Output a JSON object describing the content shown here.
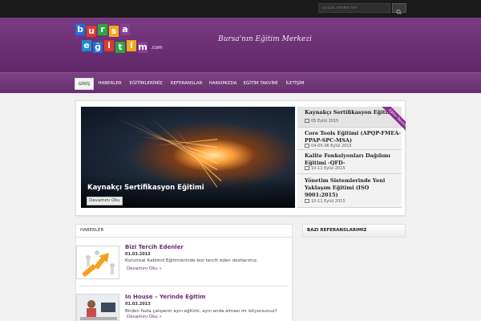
{
  "search": {
    "placeholder": "SİTEDE ARAMA YAP"
  },
  "logo": {
    "row1": [
      "b",
      "u",
      "r",
      "s",
      "a"
    ],
    "row2": [
      "e",
      "ğ",
      "i",
      "t",
      "i",
      "m"
    ],
    "suffix": ".com",
    "colors": [
      "#1f6fd6",
      "#e03c2a",
      "#2aa83a",
      "#f2a81c",
      "#8a3f9a",
      "#1b8dd1"
    ]
  },
  "tagline": "Bursa'nın Eğitim Merkezi",
  "nav": {
    "items": [
      "GİRİŞ",
      "HABERLER",
      "EĞİTİMLERİMİZ",
      "REFERANSLAR",
      "HAKKIMIZDA",
      "EĞİTİM TAKVİMİ",
      "İLETİŞİM"
    ]
  },
  "slider": {
    "ribbon": "Eğitim Takvimi",
    "main_title": "Kaynakçı Sertifikasyon Eğitimi",
    "more_label": "Devamını Oku",
    "items": [
      {
        "title": "Kaynakçı Sertifikasyon Eğitimi",
        "date": "05 Eylül 2015"
      },
      {
        "title": "Core Tools Eğitimi (APQP-FMEA-PPAP-SPC-MSA)",
        "date": "04-05-06 Eylül 2015"
      },
      {
        "title": "Kalite Fonksiyonları Dağılımı Eğitimi -QFD-",
        "date": "10-11 Eylül 2015"
      },
      {
        "title": "Yönetim Sistemlerinde Yeni Yaklaşım Eğitimi (ISO 9001:2015)",
        "date": "10-11 Eylül 2015"
      }
    ]
  },
  "news": {
    "header": "HABERLER",
    "items": [
      {
        "title": "Bizi Tercih Edenler",
        "date": "01.03.2013",
        "text": "Kurumsal Kablimli Eğitimlerinde bizi tercih eden dostlarımız.",
        "more": "Devamını Oku »"
      },
      {
        "title": "In House – Yerinde Eğitim",
        "date": "01.03.2013",
        "text": "Birden fazla çalışanın aynı eğitimi, aynı anda alması mı istiyorsunuz?",
        "more": "Devamını Oku »"
      }
    ]
  },
  "references": {
    "header": "BAZI REFERANSLARIMIZ"
  }
}
